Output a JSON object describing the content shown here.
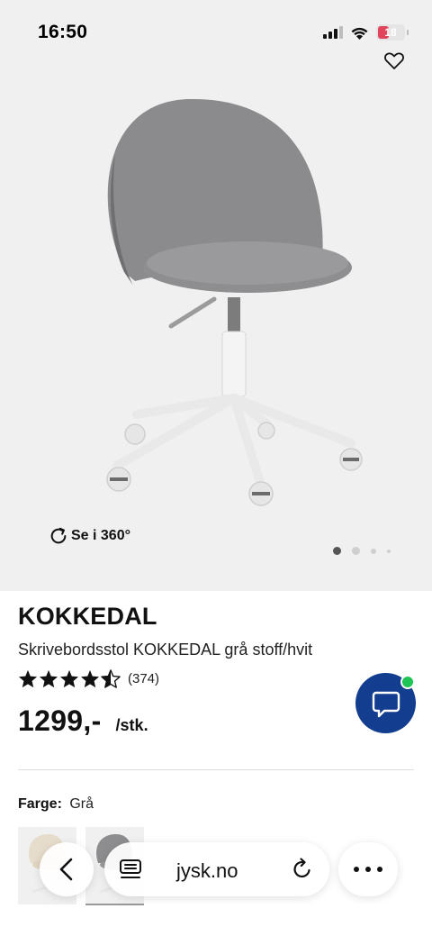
{
  "status_bar": {
    "time": "16:50",
    "battery": "18",
    "icons": [
      "cellular-signal-icon",
      "wifi-icon",
      "battery-icon"
    ]
  },
  "gallery": {
    "view_360_label": "Se i 360°",
    "image_count": 4,
    "active_image_index": 0,
    "icons": [
      "heart-icon",
      "rotate-icon"
    ]
  },
  "product": {
    "name": "KOKKEDAL",
    "description": "Skrivebordsstol KOKKEDAL grå stoff/hvit",
    "rating": 4.5,
    "rating_max": 5,
    "review_count": "(374)",
    "price": "1299,-",
    "unit": "/stk.",
    "color_label": "Farge:",
    "color_value": "Grå",
    "swatches": [
      "beige-chair-swatch",
      "grey-chair-swatch"
    ],
    "selected_swatch_index": 1
  },
  "chat": {
    "icon": "chat-bubble-icon",
    "online": true,
    "colors": {
      "button": "#133d8f",
      "online_dot": "#1fc455"
    }
  },
  "browser": {
    "url": "jysk.no",
    "icons": [
      "chevron-left-icon",
      "reader-mode-icon",
      "reload-icon",
      "more-dots-icon"
    ]
  }
}
